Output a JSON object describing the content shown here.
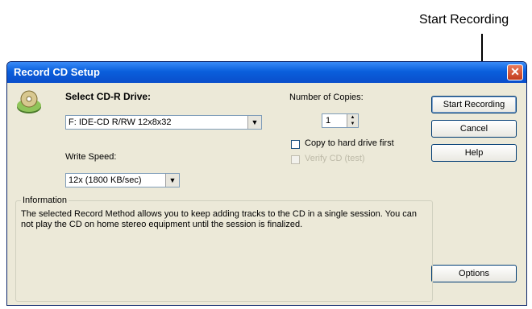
{
  "callout": {
    "label": "Start Recording"
  },
  "window": {
    "title": "Record CD Setup",
    "close_glyph": "✕"
  },
  "drive": {
    "label": "Select CD-R Drive:",
    "value": "F: IDE-CD R/RW 12x8x32"
  },
  "speed": {
    "label": "Write Speed:",
    "value": "12x (1800 KB/sec)"
  },
  "copies": {
    "label": "Number of Copies:",
    "value": "1"
  },
  "options": {
    "copy_to_hard_drive": "Copy to hard drive first",
    "verify_disabled": "Verify CD (test)"
  },
  "buttons": {
    "start": "Start Recording",
    "cancel": "Cancel",
    "help": "Help",
    "options": "Options"
  },
  "info": {
    "title": "Information",
    "text": "The selected Record Method allows you to keep adding tracks to the CD in a single session. You can not play the CD on home stereo equipment until the session is finalized."
  },
  "icons": {
    "cd": "cd-drive-icon",
    "dropdown": "chevron-down-icon"
  }
}
